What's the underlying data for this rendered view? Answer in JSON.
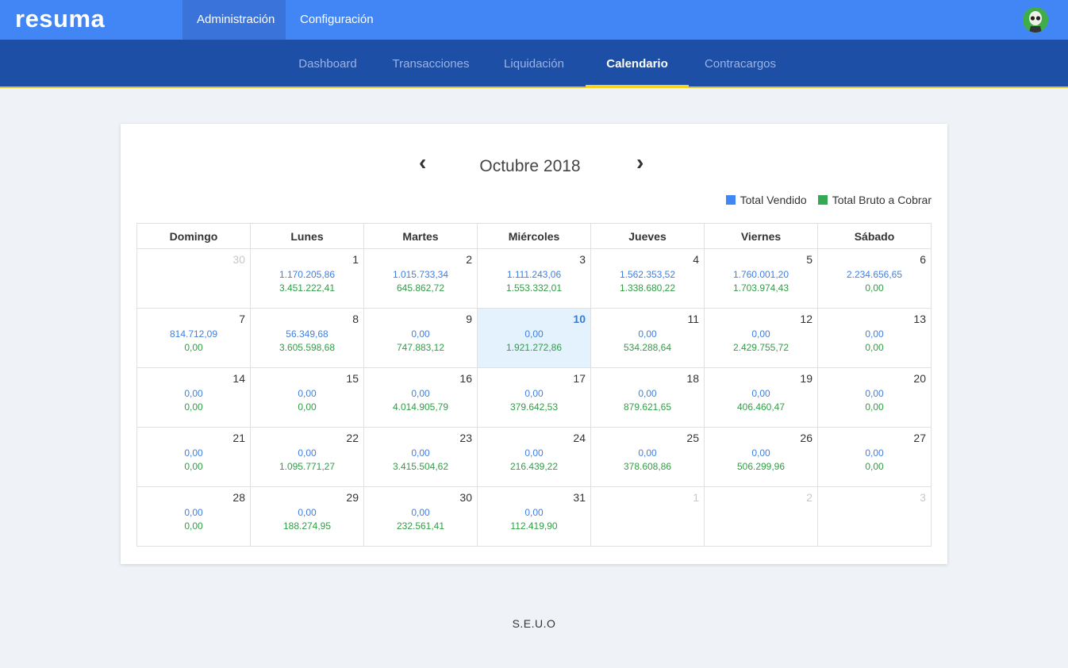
{
  "app": {
    "logo": "resuma"
  },
  "topnav": [
    {
      "label": "Administración",
      "active": true
    },
    {
      "label": "Configuración",
      "active": false
    }
  ],
  "subnav": [
    {
      "label": "Dashboard",
      "active": false
    },
    {
      "label": "Transacciones",
      "active": false
    },
    {
      "label": "Liquidación",
      "active": false
    },
    {
      "label": "Calendario",
      "active": true
    },
    {
      "label": "Contracargos",
      "active": false
    }
  ],
  "calendar": {
    "prev_icon": "chevron-left-icon",
    "next_icon": "chevron-right-icon",
    "title": "Octubre 2018",
    "legend": [
      {
        "label": "Total Vendido",
        "color": "#3f7fe0"
      },
      {
        "label": "Total Bruto a Cobrar",
        "color": "#2f9e44"
      }
    ],
    "weekdays": [
      "Domingo",
      "Lunes",
      "Martes",
      "Miércoles",
      "Jueves",
      "Viernes",
      "Sábado"
    ],
    "weeks": [
      [
        {
          "day": "30",
          "other": true,
          "vendido": "",
          "bruto": ""
        },
        {
          "day": "1",
          "vendido": "1.170.205,86",
          "bruto": "3.451.222,41"
        },
        {
          "day": "2",
          "vendido": "1.015.733,34",
          "bruto": "645.862,72"
        },
        {
          "day": "3",
          "vendido": "1.111.243,06",
          "bruto": "1.553.332,01"
        },
        {
          "day": "4",
          "vendido": "1.562.353,52",
          "bruto": "1.338.680,22"
        },
        {
          "day": "5",
          "vendido": "1.760.001,20",
          "bruto": "1.703.974,43"
        },
        {
          "day": "6",
          "vendido": "2.234.656,65",
          "bruto": "0,00"
        }
      ],
      [
        {
          "day": "7",
          "vendido": "814.712,09",
          "bruto": "0,00"
        },
        {
          "day": "8",
          "vendido": "56.349,68",
          "bruto": "3.605.598,68"
        },
        {
          "day": "9",
          "vendido": "0,00",
          "bruto": "747.883,12"
        },
        {
          "day": "10",
          "today": true,
          "vendido": "0,00",
          "bruto": "1.921.272,86"
        },
        {
          "day": "11",
          "vendido": "0,00",
          "bruto": "534.288,64"
        },
        {
          "day": "12",
          "vendido": "0,00",
          "bruto": "2.429.755,72"
        },
        {
          "day": "13",
          "vendido": "0,00",
          "bruto": "0,00"
        }
      ],
      [
        {
          "day": "14",
          "vendido": "0,00",
          "bruto": "0,00"
        },
        {
          "day": "15",
          "vendido": "0,00",
          "bruto": "0,00"
        },
        {
          "day": "16",
          "vendido": "0,00",
          "bruto": "4.014.905,79"
        },
        {
          "day": "17",
          "vendido": "0,00",
          "bruto": "379.642,53"
        },
        {
          "day": "18",
          "vendido": "0,00",
          "bruto": "879.621,65"
        },
        {
          "day": "19",
          "vendido": "0,00",
          "bruto": "406.460,47"
        },
        {
          "day": "20",
          "vendido": "0,00",
          "bruto": "0,00"
        }
      ],
      [
        {
          "day": "21",
          "vendido": "0,00",
          "bruto": "0,00"
        },
        {
          "day": "22",
          "vendido": "0,00",
          "bruto": "1.095.771,27"
        },
        {
          "day": "23",
          "vendido": "0,00",
          "bruto": "3.415.504,62"
        },
        {
          "day": "24",
          "vendido": "0,00",
          "bruto": "216.439,22"
        },
        {
          "day": "25",
          "vendido": "0,00",
          "bruto": "378.608,86"
        },
        {
          "day": "26",
          "vendido": "0,00",
          "bruto": "506.299,96"
        },
        {
          "day": "27",
          "vendido": "0,00",
          "bruto": "0,00"
        }
      ],
      [
        {
          "day": "28",
          "vendido": "0,00",
          "bruto": "0,00"
        },
        {
          "day": "29",
          "vendido": "0,00",
          "bruto": "188.274,95"
        },
        {
          "day": "30",
          "vendido": "0,00",
          "bruto": "232.561,41"
        },
        {
          "day": "31",
          "vendido": "0,00",
          "bruto": "112.419,90"
        },
        {
          "day": "1",
          "other": true,
          "vendido": "",
          "bruto": ""
        },
        {
          "day": "2",
          "other": true,
          "vendido": "",
          "bruto": ""
        },
        {
          "day": "3",
          "other": true,
          "vendido": "",
          "bruto": ""
        }
      ]
    ]
  },
  "footer": {
    "text": "S.E.U.O"
  },
  "user": {
    "avatar_icon": "user-avatar-icon"
  }
}
